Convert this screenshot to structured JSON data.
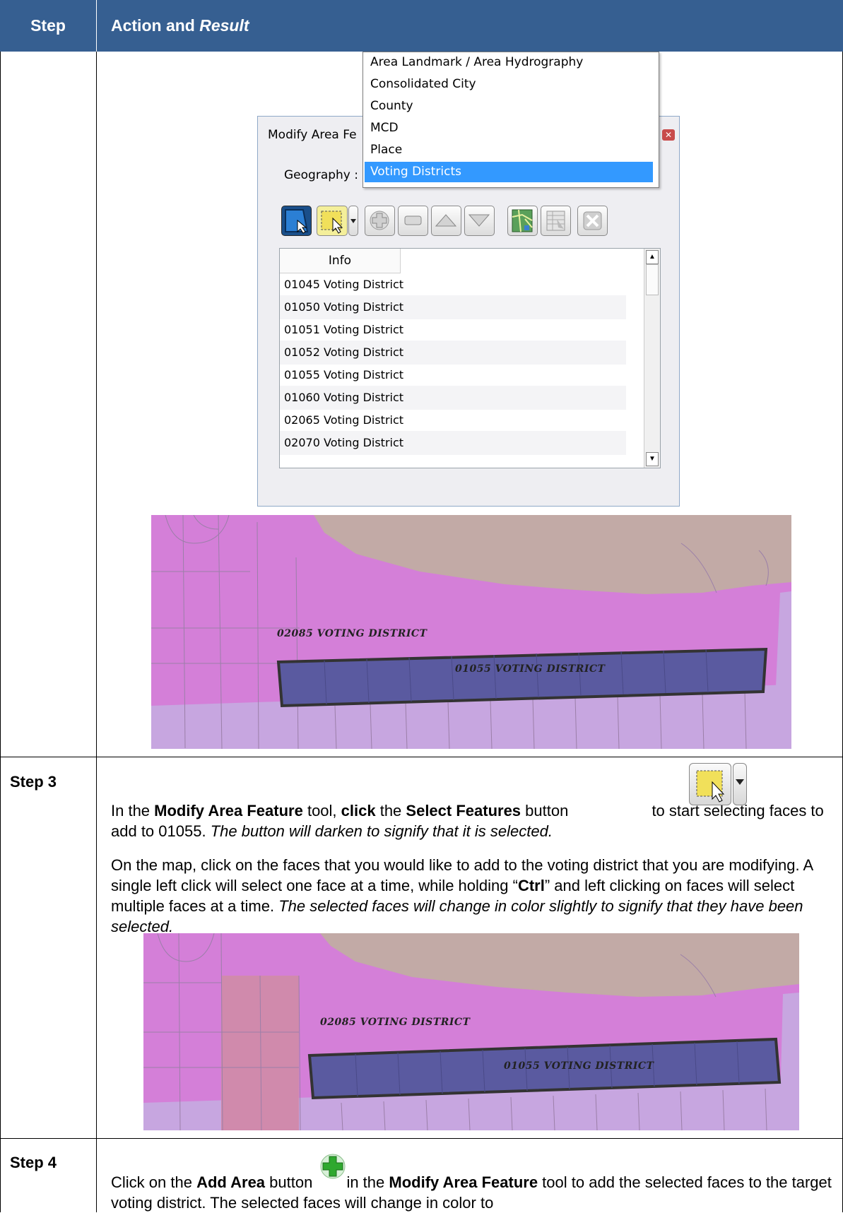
{
  "header": {
    "step_col": "Step",
    "action_col_prefix": "Action and ",
    "action_col_italic": "Result"
  },
  "dialog": {
    "title": "Modify Area Fe",
    "geography_label": "Geography :",
    "list_header": "Info",
    "rows": [
      "01045 Voting District",
      "01050 Voting District",
      "01051 Voting District",
      "01052 Voting District",
      "01055 Voting District",
      "01060 Voting District",
      "02065 Voting District",
      "02070 Voting District"
    ]
  },
  "dropdown": {
    "items": [
      "Area Landmark / Area Hydrography",
      "Consolidated City",
      "County",
      "MCD",
      "Place",
      "Voting Districts"
    ],
    "selected": "Voting Districts"
  },
  "map1": {
    "label_a": "02085 VOTING DISTRICT",
    "label_b": "01055 VOTING DISTRICT"
  },
  "map2": {
    "label_a": "02085 VOTING DISTRICT",
    "label_b": "01055 VOTING DISTRICT"
  },
  "step3": {
    "label": "Step 3",
    "p1_a": "In the ",
    "p1_b": "Modify Area Feature",
    "p1_c": " tool, ",
    "p1_d": "click",
    "p1_e": " the ",
    "p1_f": "Select Features",
    "p1_g": " button",
    "p1_h": " to start selecting faces to add to 01055. ",
    "p1_i": "The button will darken to signify that it is selected.",
    "p2_a": "On the map, click on the faces that you would like to add to the voting district that you are modifying. A single left click will select one face at a time, while holding “",
    "p2_b": "Ctrl",
    "p2_c": "” and left clicking on faces will select multiple faces at a time. ",
    "p2_d": "The selected faces will change in color slightly to signify that they have been selected."
  },
  "step4": {
    "label": "Step 4",
    "p1_a": "Click on the ",
    "p1_b": "Add Area",
    "p1_c": " button",
    "p1_d": " in the ",
    "p1_e": "Modify Area Feature",
    "p1_f": " tool to add the selected faces to the target voting district. The selected faces will change in color to"
  },
  "colors": {
    "header_bg": "#365f91",
    "selection_blue": "#3399ff",
    "district_pink": "#d47fd8",
    "district_selected": "#5a5aa0",
    "landmark_tan": "#c2aaa6",
    "lower_lavender": "#c7a6e0",
    "face_selected_rose": "#d08aac"
  }
}
